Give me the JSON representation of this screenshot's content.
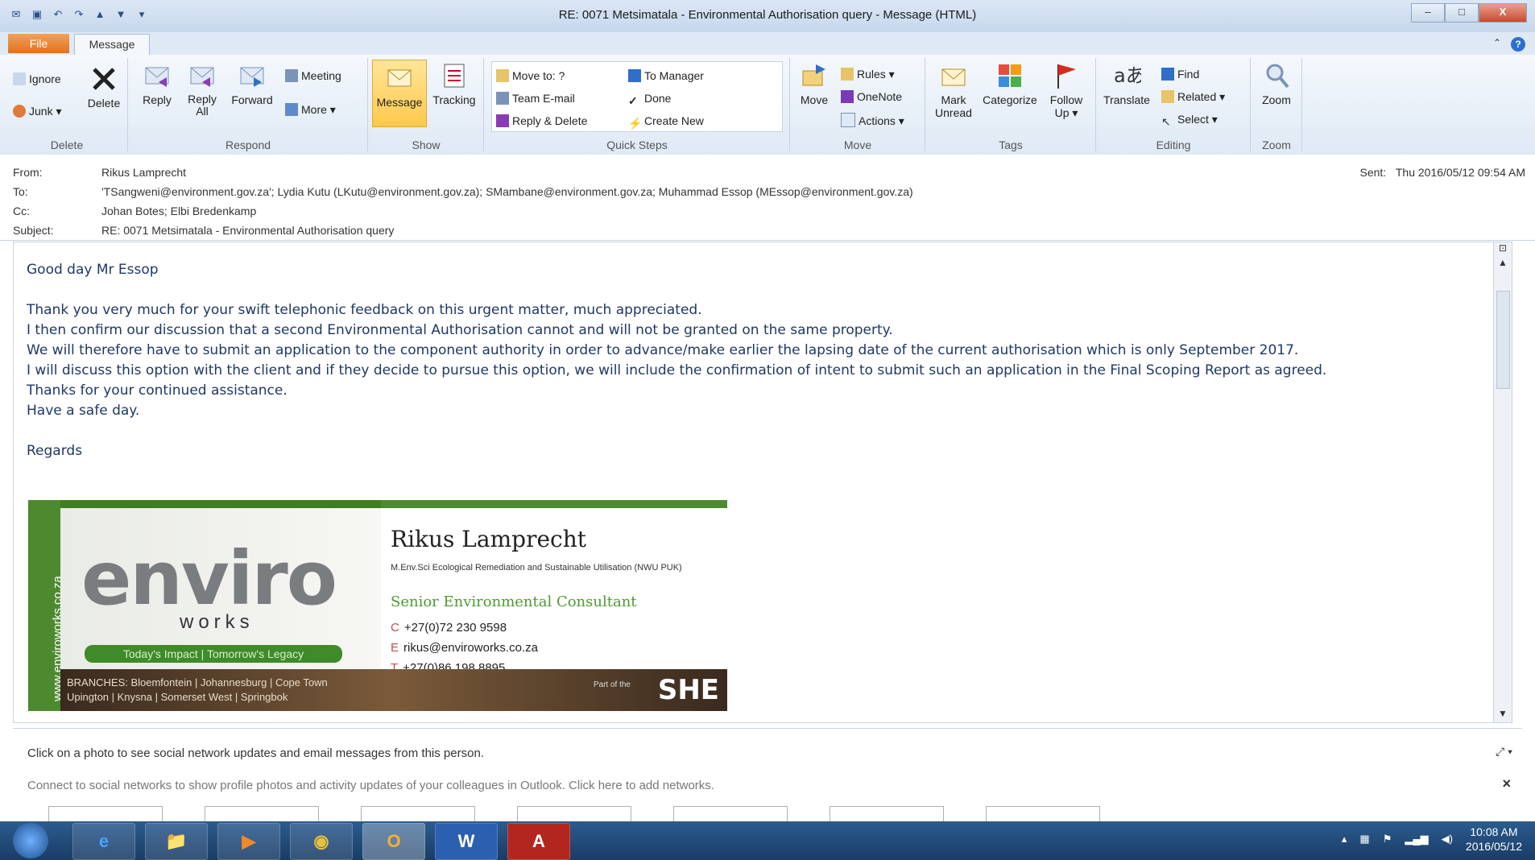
{
  "window": {
    "title": "RE: 0071 Metsimatala - Environmental Authorisation query - Message (HTML)",
    "min": "–",
    "max": "□",
    "close": "X"
  },
  "tabs": {
    "file": "File",
    "message": "Message"
  },
  "ribbon": {
    "delete_group": {
      "label": "Delete",
      "ignore": "Ignore",
      "junk": "Junk ▾",
      "delete": "Delete"
    },
    "respond_group": {
      "label": "Respond",
      "reply": "Reply",
      "reply_all": "Reply All",
      "forward": "Forward",
      "meeting": "Meeting",
      "more": "More ▾"
    },
    "show_group": {
      "label": "Show",
      "message": "Message",
      "tracking": "Tracking"
    },
    "quicksteps_group": {
      "label": "Quick Steps",
      "move_to": "Move to: ?",
      "to_manager": "To Manager",
      "team_email": "Team E-mail",
      "done": "Done",
      "reply_delete": "Reply & Delete",
      "create_new": "Create New"
    },
    "move_group": {
      "label": "Move",
      "move": "Move",
      "rules": "Rules ▾",
      "onenote": "OneNote",
      "actions": "Actions ▾"
    },
    "tags_group": {
      "label": "Tags",
      "mark_unread": "Mark Unread",
      "categorize": "Categorize",
      "follow_up": "Follow Up ▾"
    },
    "editing_group": {
      "label": "Editing",
      "translate": "Translate",
      "find": "Find",
      "related": "Related ▾",
      "select": "Select ▾"
    },
    "zoom_group": {
      "label": "Zoom",
      "zoom": "Zoom"
    }
  },
  "header": {
    "from_label": "From:",
    "from": "Rikus Lamprecht",
    "to_label": "To:",
    "to": "'TSangweni@environment.gov.za'; Lydia Kutu (LKutu@environment.gov.za); SMambane@environment.gov.za; Muhammad Essop (MEssop@environment.gov.za)",
    "cc_label": "Cc:",
    "cc": "Johan Botes; Elbi Bredenkamp",
    "subject_label": "Subject:",
    "subject": "RE: 0071 Metsimatala - Environmental Authorisation query",
    "sent_label": "Sent:",
    "sent": "Thu 2016/05/12 09:54 AM"
  },
  "body": {
    "greeting": "Good day Mr Essop",
    "line1": "Thank you very much for your swift telephonic feedback on this urgent matter, much appreciated.",
    "line2": "I then confirm our discussion that a second Environmental Authorisation cannot and will not be granted on the same property.",
    "line3": "We will therefore have to submit an application to the component authority in order to advance/make earlier the lapsing date of the current authorisation which is only September 2017.",
    "line4": "I will discuss this option with the client and if they decide to pursue this option, we will include the confirmation of intent to submit such an application in the Final Scoping Report as agreed.",
    "line5": "Thanks for your continued assistance.",
    "line6": "Have a safe day.",
    "regards": "Regards"
  },
  "signature": {
    "website": "www.enviroworks.co.za",
    "logo": "enviro",
    "logo_sub": "works",
    "tagline": "Today's Impact | Tomorrow's Legacy",
    "name": "Rikus Lamprecht",
    "quals": "M.Env.Sci Ecological Remediation and Sustainable Utilisation (NWU PUK)",
    "role": "Senior Environmental Consultant",
    "cell_prefix": "C",
    "cell": "+27(0)72 230 9598",
    "email_prefix": "E",
    "email": "rikus@enviroworks.co.za",
    "tel_prefix": "T",
    "tel": "+27(0)86 198 8895",
    "branches_1": "BRANCHES: Bloemfontein | Johannesburg | Cope Town",
    "branches_2": "Upington | Knysna | Somerset West | Springbok",
    "part_of": "Part of the",
    "she": "SHE"
  },
  "social": {
    "text1": "Click on a photo to see social network updates and email messages from this person.",
    "text2": "Connect to social networks to show profile photos and activity updates of your colleagues in Outlook. Click here to add networks.",
    "close": "×",
    "expand": "⤢ ▾"
  },
  "taskbar": {
    "time": "10:08 AM",
    "date": "2016/05/12",
    "apps": [
      "e",
      "📁",
      "▶",
      "◉",
      "O",
      "W",
      "A"
    ]
  }
}
